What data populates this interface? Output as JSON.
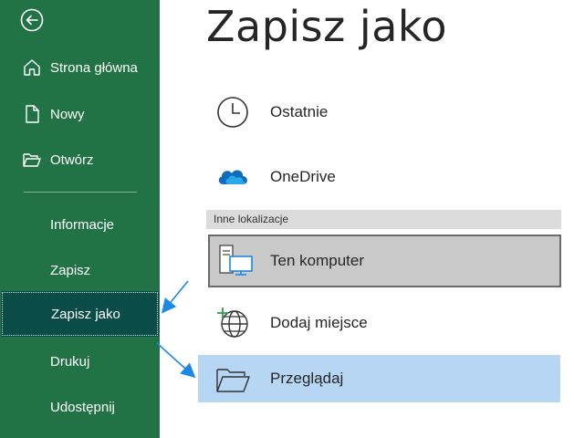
{
  "sidebar": {
    "items": [
      {
        "label": "Strona główna"
      },
      {
        "label": "Nowy"
      },
      {
        "label": "Otwórz"
      },
      {
        "label": "Informacje"
      },
      {
        "label": "Zapisz"
      },
      {
        "label": "Zapisz jako"
      },
      {
        "label": "Drukuj"
      },
      {
        "label": "Udostępnij"
      }
    ]
  },
  "main": {
    "title": "Zapisz jako",
    "recent_label": "Ostatnie",
    "onedrive_label": "OneDrive",
    "other_locations_header": "Inne lokalizacje",
    "this_pc_label": "Ten komputer",
    "add_place_label": "Dodaj miejsce",
    "browse_label": "Przeglądaj"
  },
  "colors": {
    "sidebar_bg": "#217346",
    "sidebar_active": "#0a4d48",
    "browse_highlight": "#b7d6f4",
    "selected_bg": "#c9c9c9",
    "arrow": "#1e88e5"
  }
}
